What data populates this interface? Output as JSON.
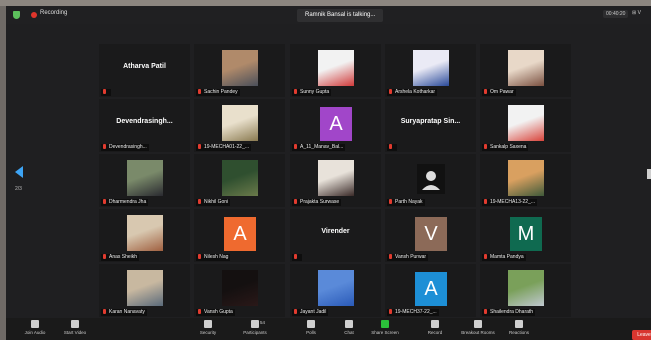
{
  "topbar": {
    "recording": "Recording",
    "speaker": "Ramnik Bansal is talking...",
    "time": "00:40:20",
    "view": "⊞ V"
  },
  "paging": {
    "page": "2/3"
  },
  "tiles": [
    {
      "name": "",
      "big": "Atharva Patil",
      "kind": "text"
    },
    {
      "name": "Sachin Pandey",
      "kind": "photo",
      "c1": "#b08a6a",
      "c2": "#4a4f5a"
    },
    {
      "name": "Sunny Gupta",
      "kind": "photo",
      "c1": "#f2f2f2",
      "c2": "#d03a3a"
    },
    {
      "name": "Arshela Kotharkar",
      "kind": "photo",
      "c1": "#eaeaf5",
      "c2": "#2a4a9a"
    },
    {
      "name": "Om Pawar",
      "kind": "photo",
      "c1": "#e8d8c8",
      "c2": "#7a5040"
    },
    {
      "name": "Devendrasingh...",
      "big": "Devendrasingh...",
      "kind": "text",
      "hideBar": true
    },
    {
      "name": "19-MECHA01-22_...",
      "kind": "photo",
      "c1": "#e9e0cc",
      "c2": "#8a7a50"
    },
    {
      "name": "A_11_Manav_Bal...",
      "kind": "letter",
      "letter": "A",
      "color": "#a146c9"
    },
    {
      "name": "",
      "big": "Suryapratap  Sin...",
      "kind": "text"
    },
    {
      "name": "Sankalp Saxena",
      "kind": "photo",
      "c1": "#f2f2f2",
      "c2": "#d9443b"
    },
    {
      "name": "Dharmendra Jha",
      "kind": "photo",
      "c1": "#7a8a6a",
      "c2": "#2a2a30"
    },
    {
      "name": "Nikhil Goni",
      "kind": "photo",
      "c1": "#2f4f2f",
      "c2": "#6a7a4a"
    },
    {
      "name": "Prajakta Surwase",
      "kind": "photo",
      "c1": "#e8e2da",
      "c2": "#3a2a28"
    },
    {
      "name": "Parth Nayak",
      "kind": "user"
    },
    {
      "name": "19-MECHA13-22_...",
      "kind": "photo",
      "c1": "#d9a060",
      "c2": "#3f5a3a"
    },
    {
      "name": "Anas Sheikh",
      "kind": "photo",
      "c1": "#d8c8b0",
      "c2": "#a06040"
    },
    {
      "name": "Nilesh Nag",
      "kind": "letter",
      "letter": "A",
      "color": "#ef6a2f"
    },
    {
      "name": "",
      "big": "Virender",
      "kind": "text"
    },
    {
      "name": "Vansh Purwar",
      "kind": "letter",
      "letter": "V",
      "color": "#8c6a58"
    },
    {
      "name": "Mamta Pandya",
      "kind": "letter",
      "letter": "M",
      "color": "#0f6a50"
    },
    {
      "name": "Karan Nanavaty",
      "kind": "photo",
      "c1": "#c8b8a0",
      "c2": "#5a6a7a"
    },
    {
      "name": "Vansh Gupta",
      "kind": "photo",
      "c1": "#141010",
      "c2": "#2a1818"
    },
    {
      "name": "Jayant Jadil",
      "kind": "photo",
      "c1": "#5a8ad9",
      "c2": "#2a5ab8"
    },
    {
      "name": "19-MECH37-22_...",
      "kind": "letter",
      "letter": "A",
      "color": "#1d8fd6"
    },
    {
      "name": "Shailendra Dharath",
      "kind": "photo",
      "c1": "#7aa05a",
      "c2": "#c0c8d0"
    }
  ],
  "toolbar": {
    "buttons": [
      {
        "label": "Join Audio",
        "icon": "headphones-icon"
      },
      {
        "label": "Start Video",
        "icon": "video-off-icon"
      },
      {
        "label": "Security",
        "icon": "shield-icon"
      },
      {
        "label": "Participants",
        "icon": "participants-icon",
        "count": "54"
      },
      {
        "label": "Polls",
        "icon": "polls-icon"
      },
      {
        "label": "Chat",
        "icon": "chat-icon"
      },
      {
        "label": "Share Screen",
        "icon": "share-screen-icon"
      },
      {
        "label": "Record",
        "icon": "record-icon"
      },
      {
        "label": "Breakout Rooms",
        "icon": "breakout-rooms-icon"
      },
      {
        "label": "Reactions",
        "icon": "reactions-icon"
      }
    ],
    "leave": "Leave"
  },
  "colors": {
    "accent": "#3da4f5",
    "share_green": "#2bbf3a",
    "leave_red": "#d8362f",
    "mute_red": "#e23b2f"
  }
}
